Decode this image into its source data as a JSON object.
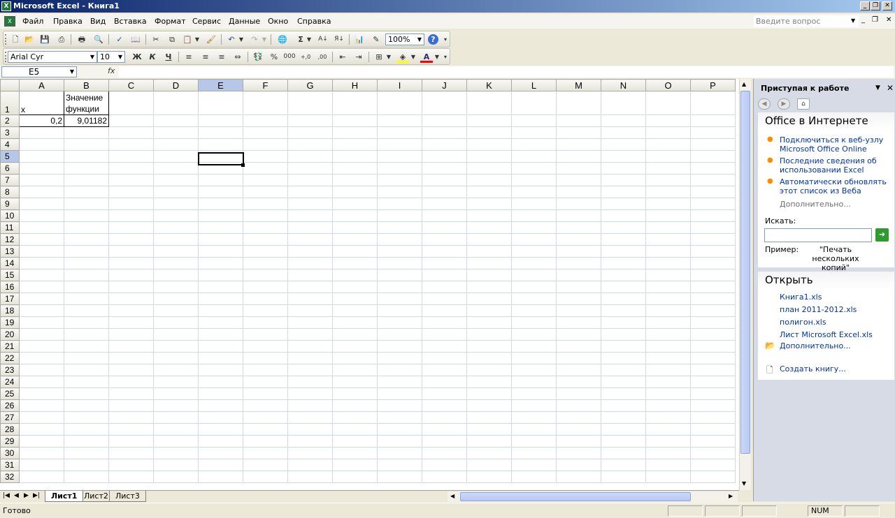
{
  "window": {
    "title": "Microsoft Excel - Книга1",
    "app_icon": "excel-icon"
  },
  "menu": {
    "items": [
      "Файл",
      "Правка",
      "Вид",
      "Вставка",
      "Формат",
      "Сервис",
      "Данные",
      "Окно",
      "Справка"
    ],
    "ask_placeholder": "Введите вопрос"
  },
  "standard_toolbar": {
    "zoom": "100%"
  },
  "format_toolbar": {
    "font": "Arial Cyr",
    "size": "10",
    "bold": "Ж",
    "italic": "К",
    "underline": "Ч"
  },
  "formula_bar": {
    "cell_ref": "E5",
    "fx": "fx",
    "value": ""
  },
  "grid": {
    "columns": [
      "A",
      "B",
      "C",
      "D",
      "E",
      "F",
      "G",
      "H",
      "I",
      "J",
      "K",
      "L",
      "M",
      "N",
      "O",
      "P"
    ],
    "selected_col": "E",
    "selected_row": 5,
    "rows": [
      "1",
      "2",
      "3",
      "4",
      "5",
      "6",
      "7",
      "8",
      "9",
      "10",
      "11",
      "12",
      "13",
      "14",
      "15",
      "16",
      "17",
      "18",
      "19",
      "20",
      "21",
      "22",
      "23",
      "24",
      "25",
      "26",
      "27",
      "28",
      "29",
      "30",
      "31",
      "32"
    ],
    "cells": {
      "A1": "x",
      "B1a": "Значение",
      "B1b": "функции",
      "A2": "0,2",
      "B2": "9,01182"
    }
  },
  "sheet_tabs": [
    "Лист1",
    "Лист2",
    "Лист3"
  ],
  "active_sheet": "Лист1",
  "status": {
    "ready": "Готово",
    "num": "NUM"
  },
  "task_pane": {
    "title": "Приступая к работе",
    "office_section": {
      "title": "Office в Интернете",
      "links": [
        {
          "l1": "Подключиться к веб-узлу",
          "l2": "Microsoft Office Online"
        },
        {
          "l1": "Последние сведения об",
          "l2": "использовании Excel"
        },
        {
          "l1": "Автоматически обновлять",
          "l2": "этот список из Веба"
        }
      ],
      "more": "Дополнительно...",
      "search_label": "Искать:",
      "search_value": "",
      "example_label": "Пример:",
      "example_l1": "\"Печать нескольких",
      "example_l2": "копий\""
    },
    "open_section": {
      "title": "Открыть",
      "files": [
        "Книга1.xls",
        "план 2011-2012.xls",
        "полигон.xls",
        "Лист Microsoft Excel.xls"
      ],
      "more": "Дополнительно..."
    },
    "create": "Создать книгу..."
  }
}
